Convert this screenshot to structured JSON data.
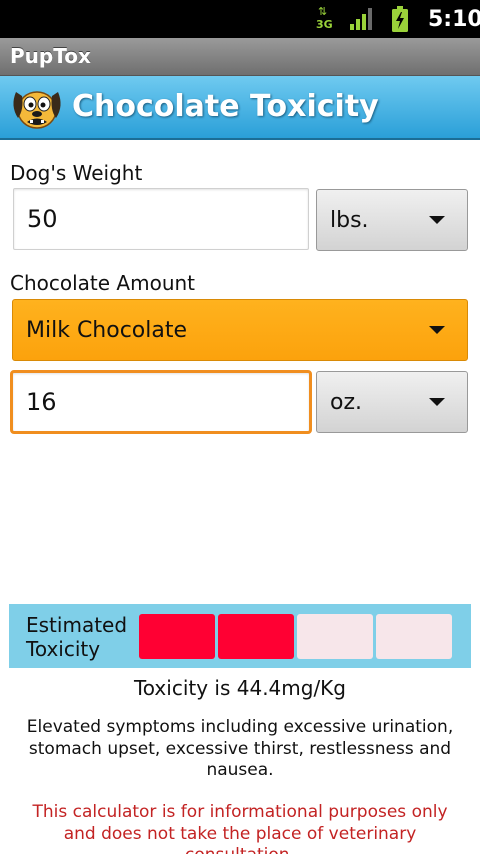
{
  "status_bar": {
    "network_label": "3G",
    "time": "5:10"
  },
  "app": {
    "title": "PupTox"
  },
  "header": {
    "logo_icon": "dog-face-icon",
    "title": "Chocolate Toxicity"
  },
  "weight": {
    "label": "Dog's Weight",
    "value": "50",
    "unit": "lbs."
  },
  "chocolate": {
    "label": "Chocolate Amount",
    "type": "Milk Chocolate",
    "amount": "16",
    "unit": "oz."
  },
  "meter": {
    "label_line1": "Estimated",
    "label_line2": "Toxicity",
    "level": 2,
    "segments": 4,
    "active_color": "#ff0033",
    "inactive_color": "#f7e6ea"
  },
  "result": {
    "toxicity_text": "Toxicity is 44.4mg/Kg",
    "symptoms": "Elevated symptoms including excessive urination, stomach upset, excessive thirst, restlessness and nausea.",
    "disclaimer": "This calculator is for informational purposes only and does not take the place of veterinary consultation."
  },
  "colors": {
    "header_blue": "#2a9fd8",
    "selected_orange": "#fca20c",
    "focus_border": "#f08e1f",
    "disclaimer_red": "#c32323"
  }
}
